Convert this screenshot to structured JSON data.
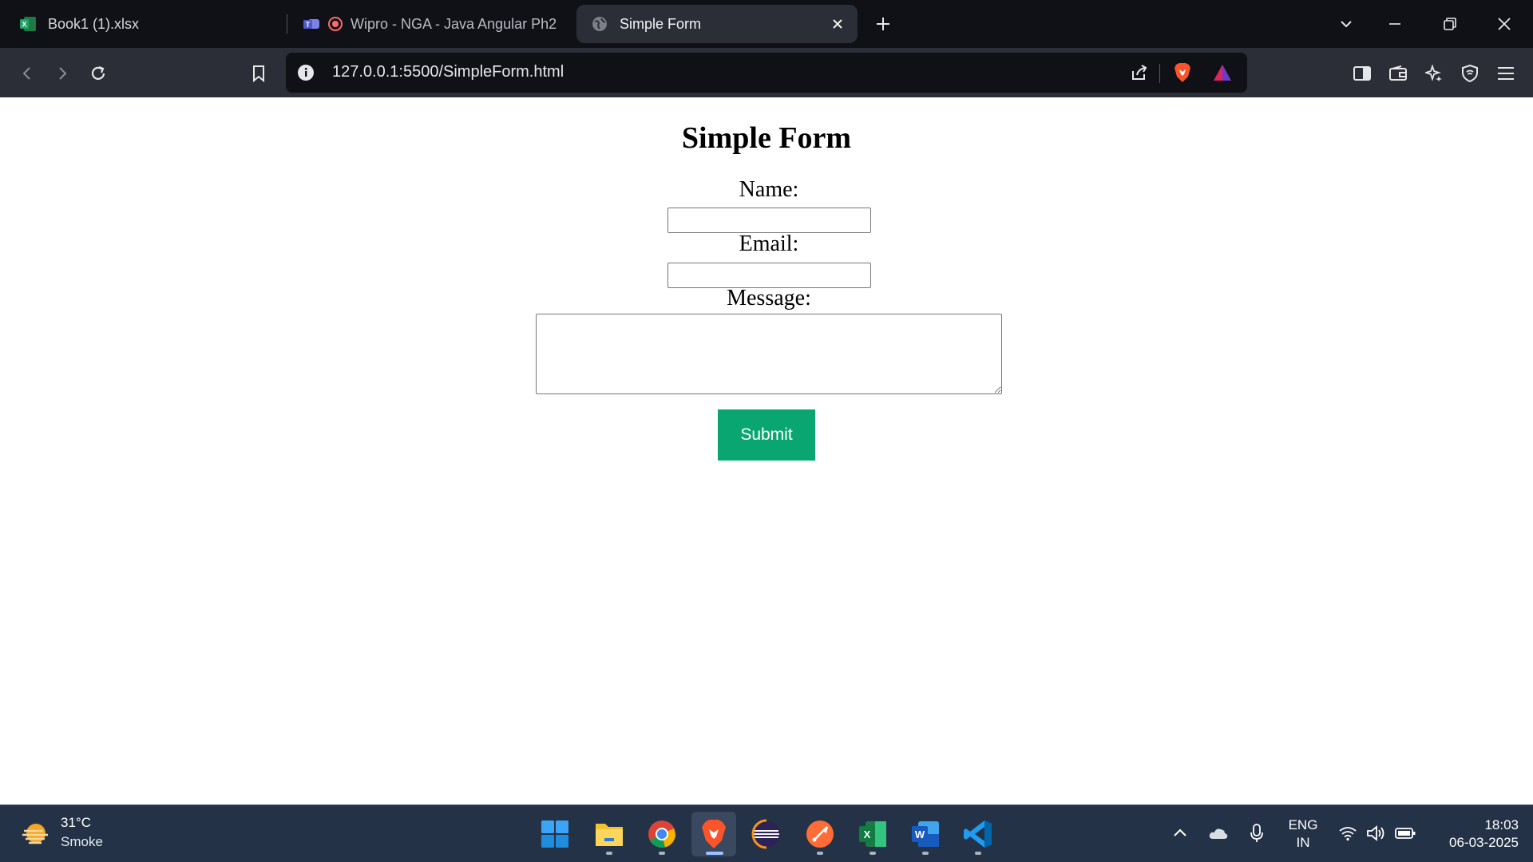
{
  "browser": {
    "tabs": [
      {
        "title": "Book1 (1).xlsx",
        "icon": "excel-icon"
      },
      {
        "title": "Wipro - NGA - Java Angular Ph2",
        "icon": "teams-icon"
      },
      {
        "title": "Simple Form",
        "icon": "globe-icon",
        "active": true
      }
    ],
    "address": "127.0.0.1:5500/SimpleForm.html"
  },
  "page": {
    "title": "Simple Form",
    "name_label": "Name:",
    "email_label": "Email:",
    "message_label": "Message:",
    "name_value": "",
    "email_value": "",
    "message_value": "",
    "submit_label": "Submit",
    "submit_color": "#0aa672"
  },
  "taskbar": {
    "weather_temp": "31°C",
    "weather_desc": "Smoke",
    "apps": [
      "start-icon",
      "file-explorer-icon",
      "chrome-icon",
      "brave-icon",
      "eclipse-icon",
      "postman-icon",
      "excel-icon",
      "word-icon",
      "vscode-icon"
    ],
    "lang_line1": "ENG",
    "lang_line2": "IN",
    "time": "18:03",
    "date": "06-03-2025"
  }
}
